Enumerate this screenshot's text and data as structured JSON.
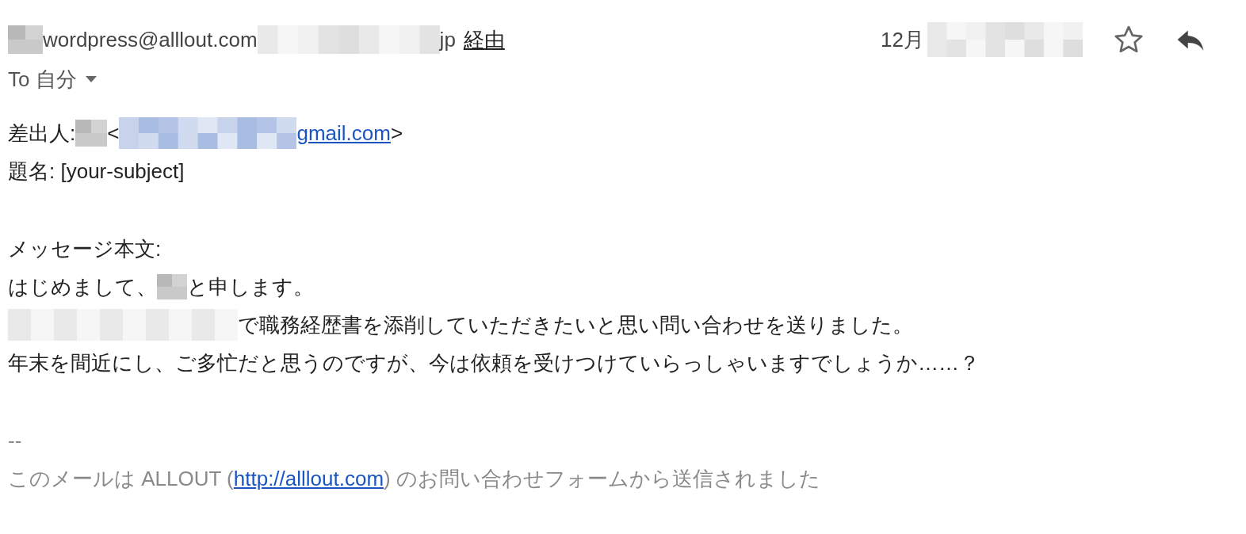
{
  "header": {
    "sender": "wordpress@alllout.com",
    "via_suffix": "jp",
    "via_label": "経由",
    "date_prefix": "12月",
    "recipient": "To 自分"
  },
  "body": {
    "from_label": "差出人:",
    "email_open": "<",
    "email_suffix": "gmail.com",
    "email_close": ">",
    "subject": "題名: [your-subject]",
    "message_label": "メッセージ本文:",
    "greeting_start": "はじめまして、",
    "greeting_end": "と申します。",
    "request": "で職務経歴書を添削していただきたいと思い問い合わせを送りました。",
    "question": "年末を間近にし、ご多忙だと思うのですが、今は依頼を受けつけていらっしゃいますでしょうか……？"
  },
  "signature": {
    "separator": "--",
    "text_start": "このメールは ALLOUT (",
    "link": "http://alllout.com",
    "text_end": ") のお問い合わせフォームから送信されました"
  }
}
